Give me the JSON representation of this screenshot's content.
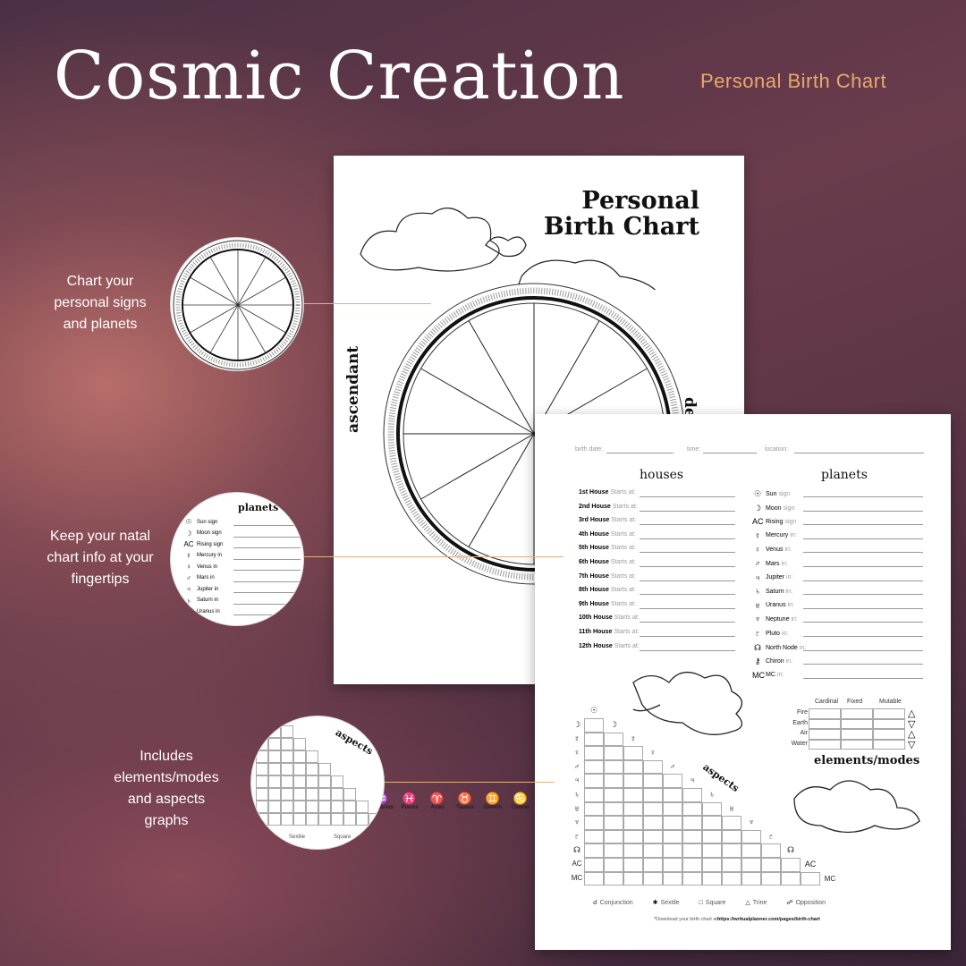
{
  "title": "Cosmic Creation",
  "subtitle": "Personal Birth Chart",
  "accent_color": "#eaa86c",
  "captions": [
    {
      "lines": [
        "Chart your",
        "personal signs",
        "and planets"
      ]
    },
    {
      "lines": [
        "Keep your natal",
        "chart info at your",
        "fingertips"
      ]
    },
    {
      "lines": [
        "Includes",
        "elements/modes",
        "and aspects",
        "graphs"
      ]
    }
  ],
  "page1": {
    "title_lines": [
      "Personal",
      "Birth Chart"
    ],
    "ascendant": "ascendant",
    "descendant": "de",
    "zodiac": [
      {
        "glyph": "♒",
        "label": "Aquarius"
      },
      {
        "glyph": "♓",
        "label": "Pisces"
      },
      {
        "glyph": "♈",
        "label": "Aries"
      },
      {
        "glyph": "♉",
        "label": "Taurus"
      },
      {
        "glyph": "♊",
        "label": "Gemini"
      },
      {
        "glyph": "♋",
        "label": "Cancer"
      }
    ]
  },
  "page2": {
    "fields": [
      {
        "label": "birth date:"
      },
      {
        "label": "time:"
      },
      {
        "label": "location:"
      }
    ],
    "houses_title": "houses",
    "houses": [
      "1st House",
      "2nd House",
      "3rd House",
      "4th House",
      "5th House",
      "6th House",
      "7th House",
      "8th House",
      "9th House",
      "10th House",
      "11th House",
      "12th House"
    ],
    "starts_at": "Starts at:",
    "planets_title": "planets",
    "planets": [
      {
        "glyph": "☉",
        "name": "Sun",
        "suffix": "sign"
      },
      {
        "glyph": "☽",
        "name": "Moon",
        "suffix": "sign"
      },
      {
        "glyph": "AC",
        "name": "Rising",
        "suffix": "sign"
      },
      {
        "glyph": "☿",
        "name": "Mercury",
        "suffix": "in:"
      },
      {
        "glyph": "♀",
        "name": "Venus",
        "suffix": "in:"
      },
      {
        "glyph": "♂",
        "name": "Mars",
        "suffix": "in:"
      },
      {
        "glyph": "♃",
        "name": "Jupiter",
        "suffix": "in:"
      },
      {
        "glyph": "♄",
        "name": "Saturn",
        "suffix": "in:"
      },
      {
        "glyph": "♅",
        "name": "Uranus",
        "suffix": "in:"
      },
      {
        "glyph": "♆",
        "name": "Neptune",
        "suffix": "in:"
      },
      {
        "glyph": "♇",
        "name": "Pluto",
        "suffix": "in:"
      },
      {
        "glyph": "☊",
        "name": "North Node",
        "suffix": "in:"
      },
      {
        "glyph": "⚷",
        "name": "Chiron",
        "suffix": "in:"
      },
      {
        "glyph": "MC",
        "name": "MC",
        "suffix": "in:"
      }
    ],
    "modes": [
      "Cardinal",
      "Fixed",
      "Mutable"
    ],
    "elements": [
      {
        "name": "Fire",
        "glyph": "△"
      },
      {
        "name": "Earth",
        "glyph": "▽"
      },
      {
        "name": "Air",
        "glyph": "△"
      },
      {
        "name": "Water",
        "glyph": "▽"
      }
    ],
    "elements_title": "elements/modes",
    "aspects_title": "aspects",
    "aspect_columns": [
      "☉",
      "☽",
      "☿",
      "♀",
      "♂",
      "♃",
      "♄",
      "♅",
      "♆",
      "♇",
      "☊",
      "AC",
      "MC"
    ],
    "aspect_rows": [
      "☽",
      "☿",
      "♀",
      "♂",
      "♃",
      "♄",
      "♅",
      "♆",
      "♇",
      "☊",
      "AC",
      "MC"
    ],
    "legend": [
      {
        "glyph": "☌",
        "label": "Conjunction"
      },
      {
        "glyph": "✱",
        "label": "Sextile"
      },
      {
        "glyph": "□",
        "label": "Square"
      },
      {
        "glyph": "△",
        "label": "Trine"
      },
      {
        "glyph": "☍",
        "label": "Opposition"
      }
    ],
    "footer_prefix": "*Download your birth chart at ",
    "footer_url": "https://writualplanner.com/pages/birth-chart"
  },
  "zoom2": {
    "title": "planets",
    "rows": [
      {
        "g": "☉",
        "t": "Sun sign"
      },
      {
        "g": "☽",
        "t": "Moon sign"
      },
      {
        "g": "AC",
        "t": "Rising sign"
      },
      {
        "g": "☿",
        "t": "Mercury in"
      },
      {
        "g": "♀",
        "t": "Venus in"
      },
      {
        "g": "♂",
        "t": "Mars in"
      },
      {
        "g": "♃",
        "t": "Jupiter in"
      },
      {
        "g": "♄",
        "t": "Saturn in"
      },
      {
        "g": "♅",
        "t": "Uranus in"
      }
    ]
  },
  "zoom3": {
    "title": "aspects",
    "legend": [
      "Sextile",
      "Square"
    ]
  }
}
